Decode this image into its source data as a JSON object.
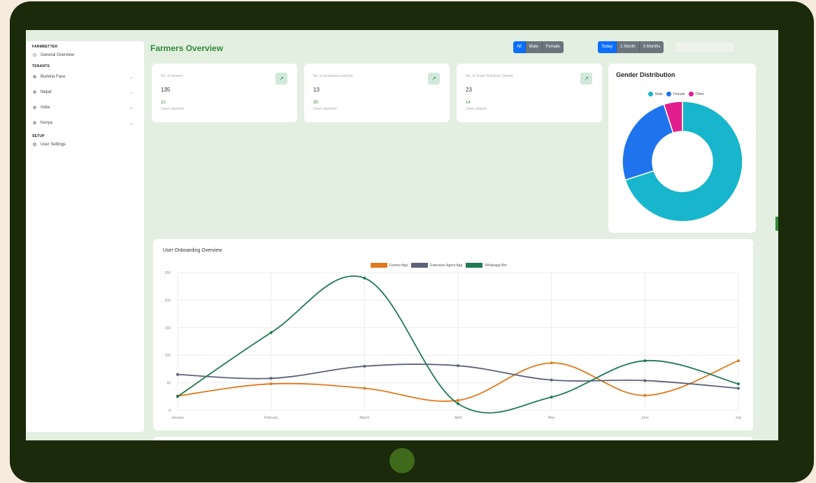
{
  "sidebar": {
    "sections": [
      "FARMBETTER",
      "TENANTS",
      "SETUP"
    ],
    "general_overview": "General Overview",
    "tenants": [
      {
        "label": "Burkina Faso",
        "icon": "globe-icon"
      },
      {
        "label": "Nepal",
        "icon": "globe-icon"
      },
      {
        "label": "India",
        "icon": "globe-icon"
      },
      {
        "label": "Kenya",
        "icon": "globe-icon"
      }
    ],
    "user_settings": "User Settings"
  },
  "header": {
    "title": "Farmers Overview",
    "gender_filter": [
      "All",
      "Male",
      "Female"
    ],
    "gender_selected": "All",
    "period_filter": [
      "Today",
      "1 Month",
      "3 Months"
    ],
    "period_selected": "Today"
  },
  "stats": [
    {
      "label": "No. of farmers",
      "value": "135",
      "delta": "10",
      "sub": "Users reported",
      "icon": "chart-icon"
    },
    {
      "label": "No. of producers reached",
      "value": "13",
      "delta": "35",
      "sub": "Users reported",
      "icon": "chart-icon"
    },
    {
      "label": "No. of Share Practices Shared",
      "value": "23",
      "delta": "14",
      "sub": "Users shared",
      "icon": "chart-icon"
    }
  ],
  "gender": {
    "title": "Gender Distribution",
    "labels": [
      "Male",
      "Female",
      "Other"
    ],
    "values": [
      70,
      25,
      5
    ],
    "colors": [
      "#17b6cc",
      "#1f74ee",
      "#e21e8f"
    ]
  },
  "colors": {
    "accent": "#2f8b3a",
    "primary": "#0d6efd",
    "frame": "#1a2a0b"
  },
  "chart_data": {
    "type": "line",
    "title": "User Onboarding Overview",
    "categories": [
      "January",
      "February",
      "March",
      "April",
      "May",
      "June",
      "July"
    ],
    "ylim": [
      0,
      250
    ],
    "yticks": [
      "0",
      "50",
      "100",
      "150",
      "200",
      "250"
    ],
    "grid": true,
    "legend": "top",
    "series": [
      {
        "name": "Farmer App",
        "color": "#e07a1f",
        "values": [
          26,
          48,
          40,
          18,
          86,
          27,
          90
        ]
      },
      {
        "name": "Extension Agent App",
        "color": "#5c6277",
        "values": [
          65,
          58,
          80,
          81,
          55,
          54,
          40
        ]
      },
      {
        "name": "Whatsapp Bot",
        "color": "#207a52",
        "values": [
          25,
          141,
          240,
          12,
          24,
          90,
          48
        ]
      }
    ]
  }
}
